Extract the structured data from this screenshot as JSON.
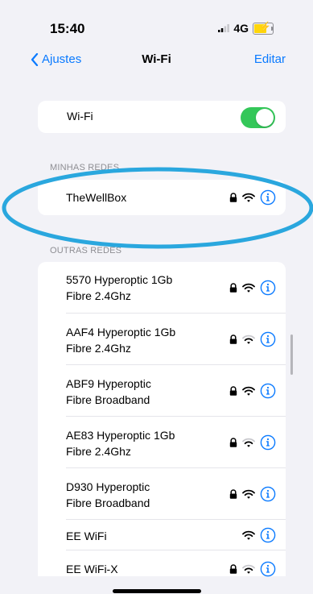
{
  "status_bar": {
    "time": "15:40",
    "network": "4G"
  },
  "nav": {
    "back_label": "Ajustes",
    "title": "Wi-Fi",
    "edit_label": "Editar"
  },
  "wifi_toggle": {
    "label": "Wi-Fi",
    "enabled": true
  },
  "my_networks": {
    "header": "MINHAS REDES",
    "items": [
      {
        "name": "TheWellBox",
        "locked": true
      }
    ]
  },
  "other_networks": {
    "header": "OUTRAS REDES",
    "items": [
      {
        "line1": "5570 Hyperoptic 1Gb",
        "line2": "Fibre 2.4Ghz",
        "locked": true
      },
      {
        "line1": "AAF4 Hyperoptic 1Gb",
        "line2": "Fibre 2.4Ghz",
        "locked": true
      },
      {
        "line1": "ABF9 Hyperoptic",
        "line2": "Fibre Broadband",
        "locked": true
      },
      {
        "line1": "AE83 Hyperoptic 1Gb",
        "line2": "Fibre 2.4Ghz",
        "locked": true
      },
      {
        "line1": "D930 Hyperoptic",
        "line2": "Fibre Broadband",
        "locked": true
      },
      {
        "line1": "EE WiFi",
        "line2": "",
        "locked": false
      },
      {
        "line1": "EE WiFi-X",
        "line2": "",
        "locked": true
      }
    ]
  },
  "colors": {
    "accent": "#0a7aff",
    "toggle_on": "#34c759",
    "annotation": "#2aa7de"
  }
}
